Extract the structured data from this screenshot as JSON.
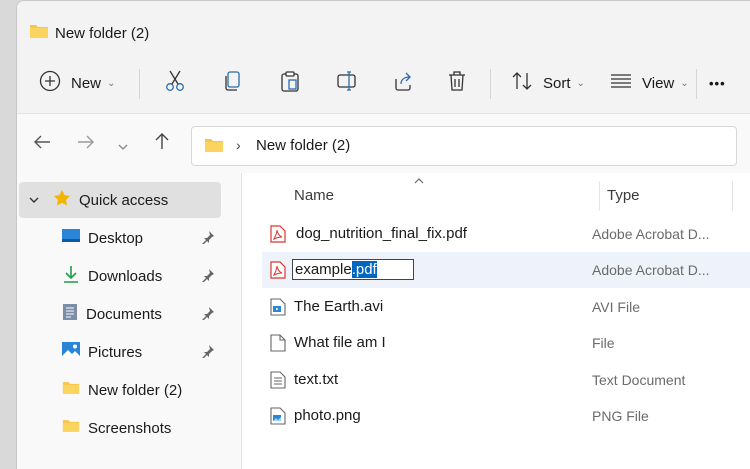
{
  "window": {
    "title": "New folder (2)"
  },
  "toolbar": {
    "new_label": "New",
    "sort_label": "Sort",
    "view_label": "View",
    "more_label": "•••"
  },
  "address": {
    "separator": "›",
    "crumb": "New folder (2)"
  },
  "sidebar": {
    "quick_access": "Quick access",
    "items": [
      {
        "label": "Desktop",
        "icon": "desktop-icon",
        "pinned": true
      },
      {
        "label": "Downloads",
        "icon": "download-icon",
        "pinned": true
      },
      {
        "label": "Documents",
        "icon": "documents-icon",
        "pinned": true
      },
      {
        "label": "Pictures",
        "icon": "pictures-icon",
        "pinned": true
      },
      {
        "label": "New folder (2)",
        "icon": "folder-icon",
        "pinned": false
      },
      {
        "label": "Screenshots",
        "icon": "folder-icon",
        "pinned": false
      }
    ]
  },
  "columns": {
    "name": "Name",
    "type": "Type"
  },
  "files": [
    {
      "name": "dog_nutrition_final_fix.pdf",
      "type": "Adobe Acrobat D...",
      "icon": "pdf-icon"
    },
    {
      "name": "example.pdf",
      "rename_base": "example",
      "rename_ext": ".pdf",
      "type": "Adobe Acrobat D...",
      "icon": "pdf-icon"
    },
    {
      "name": "The Earth.avi",
      "type": "AVI File",
      "icon": "video-file-icon"
    },
    {
      "name": "What file am I",
      "type": "File",
      "icon": "blank-file-icon"
    },
    {
      "name": "text.txt",
      "type": "Text Document",
      "icon": "text-file-icon"
    },
    {
      "name": "photo.png",
      "type": "PNG File",
      "icon": "image-file-icon"
    }
  ],
  "colors": {
    "accent": "#0067c0",
    "folder": "#f7c547",
    "pdf": "#d9362b"
  }
}
